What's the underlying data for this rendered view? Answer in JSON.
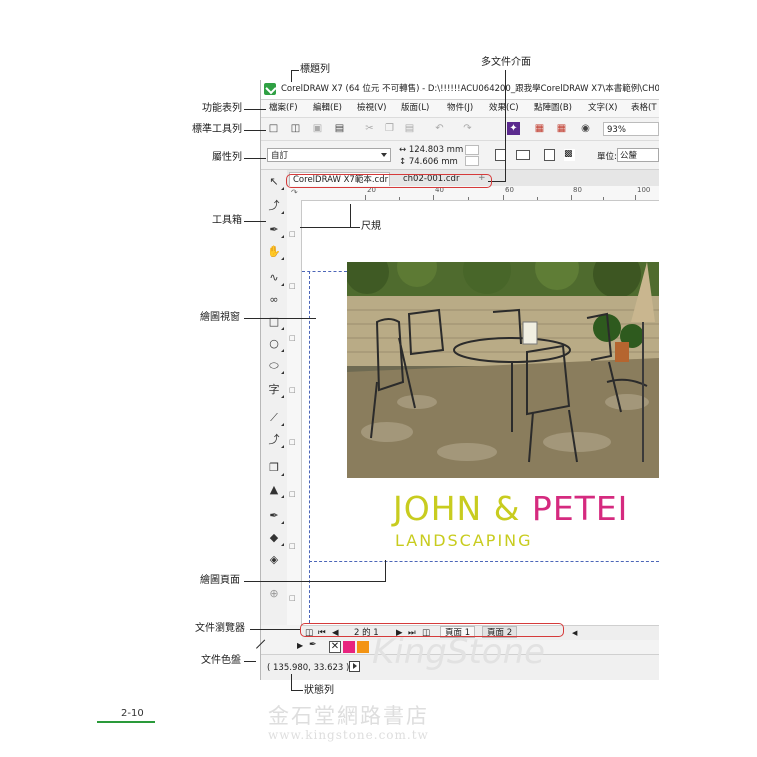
{
  "annotations": {
    "title_bar": "標題列",
    "multi_doc": "多文件介面",
    "menu_bar": "功能表列",
    "standard_toolbar": "標準工具列",
    "property_bar": "屬性列",
    "toolbox": "工具箱",
    "ruler": "尺規",
    "drawing_window": "繪圖視窗",
    "drawing_page": "繪圖頁面",
    "doc_navigator": "文件瀏覽器",
    "doc_palette": "文件色盤",
    "status_bar": "狀態列"
  },
  "window": {
    "title": "CorelDRAW X7 (64 位元 不可轉售) - D:\\!!!!!!ACU064200_跟我學CorelDRAW  X7\\本書範例\\CH0"
  },
  "menu": [
    "檔案(F)",
    "編輯(E)",
    "檢視(V)",
    "版面(L)",
    "物件(J)",
    "效果(C)",
    "點陣圖(B)",
    "文字(X)",
    "表格(T"
  ],
  "toolbar": {
    "zoom": "93%"
  },
  "property_bar": {
    "paper": "自訂",
    "width": "124.803 mm",
    "height": "74.606 mm",
    "units_label": "單位:",
    "units_value": "公釐"
  },
  "doc_tabs": [
    "CorelDRAW X7範本.cdr",
    "ch02-001.cdr"
  ],
  "ruler_ticks": [
    "20",
    "40",
    "60",
    "80",
    "100"
  ],
  "canvas": {
    "brand_part1": "JOHN & ",
    "brand_part2": "PETEI",
    "brand_sub": "LANDSCAPING"
  },
  "navigator": {
    "page_count": "2 的 1",
    "pages": [
      "頁面 1",
      "頁面 2"
    ]
  },
  "palette": {
    "colors": [
      "#e8247e",
      "#f39414"
    ]
  },
  "status": {
    "coords": "( 135.980, 33.623 )"
  },
  "page": {
    "number": "2-10",
    "watermark_cn": "金石堂網路書店",
    "watermark_url": "www.kingstone.com.tw",
    "watermark_logo": "KingStone"
  }
}
